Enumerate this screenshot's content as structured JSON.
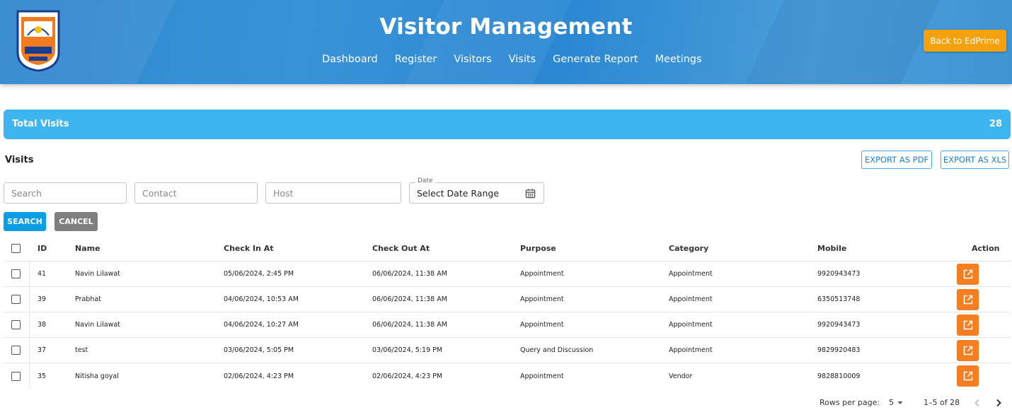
{
  "header": {
    "title": "Visitor Management",
    "nav": [
      "Dashboard",
      "Register",
      "Visitors",
      "Visits",
      "Generate Report",
      "Meetings"
    ],
    "back_button": "Back to EdPrime",
    "logo_icon": "school-emblem-logo"
  },
  "summary": {
    "label": "Total Visits",
    "value": "28",
    "color": "#3fb5f0"
  },
  "visits": {
    "title": "Visits",
    "export_pdf": "EXPORT AS PDF",
    "export_xls": "EXPORT AS XLS"
  },
  "filters": {
    "search_placeholder": "Search",
    "contact_placeholder": "Contact",
    "host_placeholder": "Host",
    "date_label": "Date",
    "date_value": "Select Date Range",
    "search_button": "SEARCH",
    "cancel_button": "CANCEL"
  },
  "table": {
    "columns": [
      "ID",
      "Name",
      "Check In At",
      "Check Out At",
      "Purpose",
      "Category",
      "Mobile",
      "Action"
    ],
    "rows": [
      {
        "id": "41",
        "name": "Navin Lilawat",
        "check_in": "05/06/2024, 2:45 PM",
        "check_out": "06/06/2024, 11:38 AM",
        "purpose": "Appointment",
        "category": "Appointment",
        "mobile": "9920943473"
      },
      {
        "id": "39",
        "name": "Prabhat",
        "check_in": "04/06/2024, 10:53 AM",
        "check_out": "06/06/2024, 11:38 AM",
        "purpose": "Appointment",
        "category": "Appointment",
        "mobile": "6350513748"
      },
      {
        "id": "38",
        "name": "Navin Lilawat",
        "check_in": "04/06/2024, 10:27 AM",
        "check_out": "06/06/2024, 11:38 AM",
        "purpose": "Appointment",
        "category": "Appointment",
        "mobile": "9920943473"
      },
      {
        "id": "37",
        "name": "test",
        "check_in": "03/06/2024, 5:05 PM",
        "check_out": "03/06/2024, 5:19 PM",
        "purpose": "Query and Discussion",
        "category": "Appointment",
        "mobile": "9829920483"
      },
      {
        "id": "35",
        "name": "Nitisha goyal",
        "check_in": "02/06/2024, 4:23 PM",
        "check_out": "02/06/2024, 4:23 PM",
        "purpose": "Appointment",
        "category": "Vendor",
        "mobile": "9828810009"
      }
    ]
  },
  "pagination": {
    "rows_per_page_label": "Rows per page:",
    "rows_per_page": "5",
    "range": "1–5 of 28"
  },
  "colors": {
    "accent": "#0c9ee5",
    "action": "#f47f22",
    "back_button": "#f5a10c"
  }
}
